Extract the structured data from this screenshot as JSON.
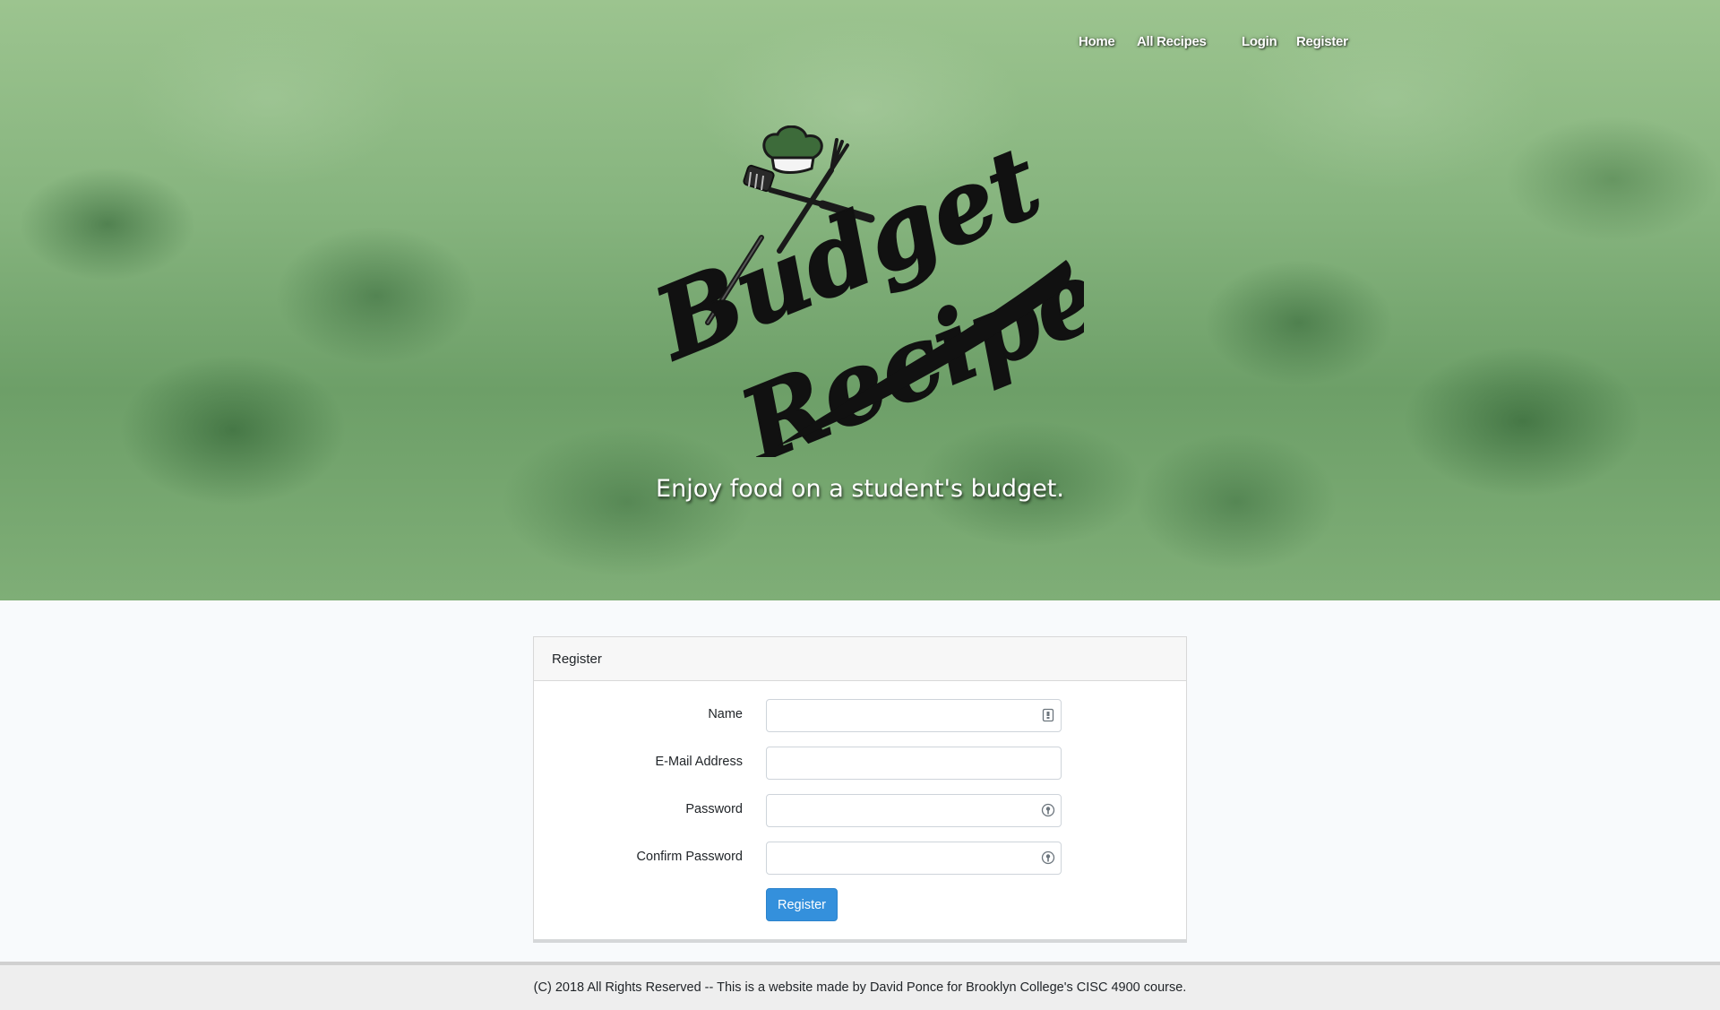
{
  "nav": {
    "home": "Home",
    "all_recipes": "All Recipes",
    "login": "Login",
    "register": "Register"
  },
  "hero": {
    "logo_text_line1": "Budget",
    "logo_text_line2": "Recipes",
    "tagline": "Enjoy food on a student's budget."
  },
  "card": {
    "header": "Register",
    "fields": [
      {
        "label": "Name",
        "value": "",
        "icon": "contact-card-icon"
      },
      {
        "label": "E-Mail Address",
        "value": ""
      },
      {
        "label": "Password",
        "value": "",
        "icon": "key-icon"
      },
      {
        "label": "Confirm Password",
        "value": "",
        "icon": "key-icon"
      }
    ],
    "submit_label": "Register"
  },
  "footer": {
    "text": "(C) 2018 All Rights Reserved -- This is a website made by David Ponce for Brooklyn College's CISC 4900 course."
  },
  "colors": {
    "primary_button": "#3490dc",
    "page_background": "#f8fafc",
    "footer_background": "#eeeeee"
  }
}
